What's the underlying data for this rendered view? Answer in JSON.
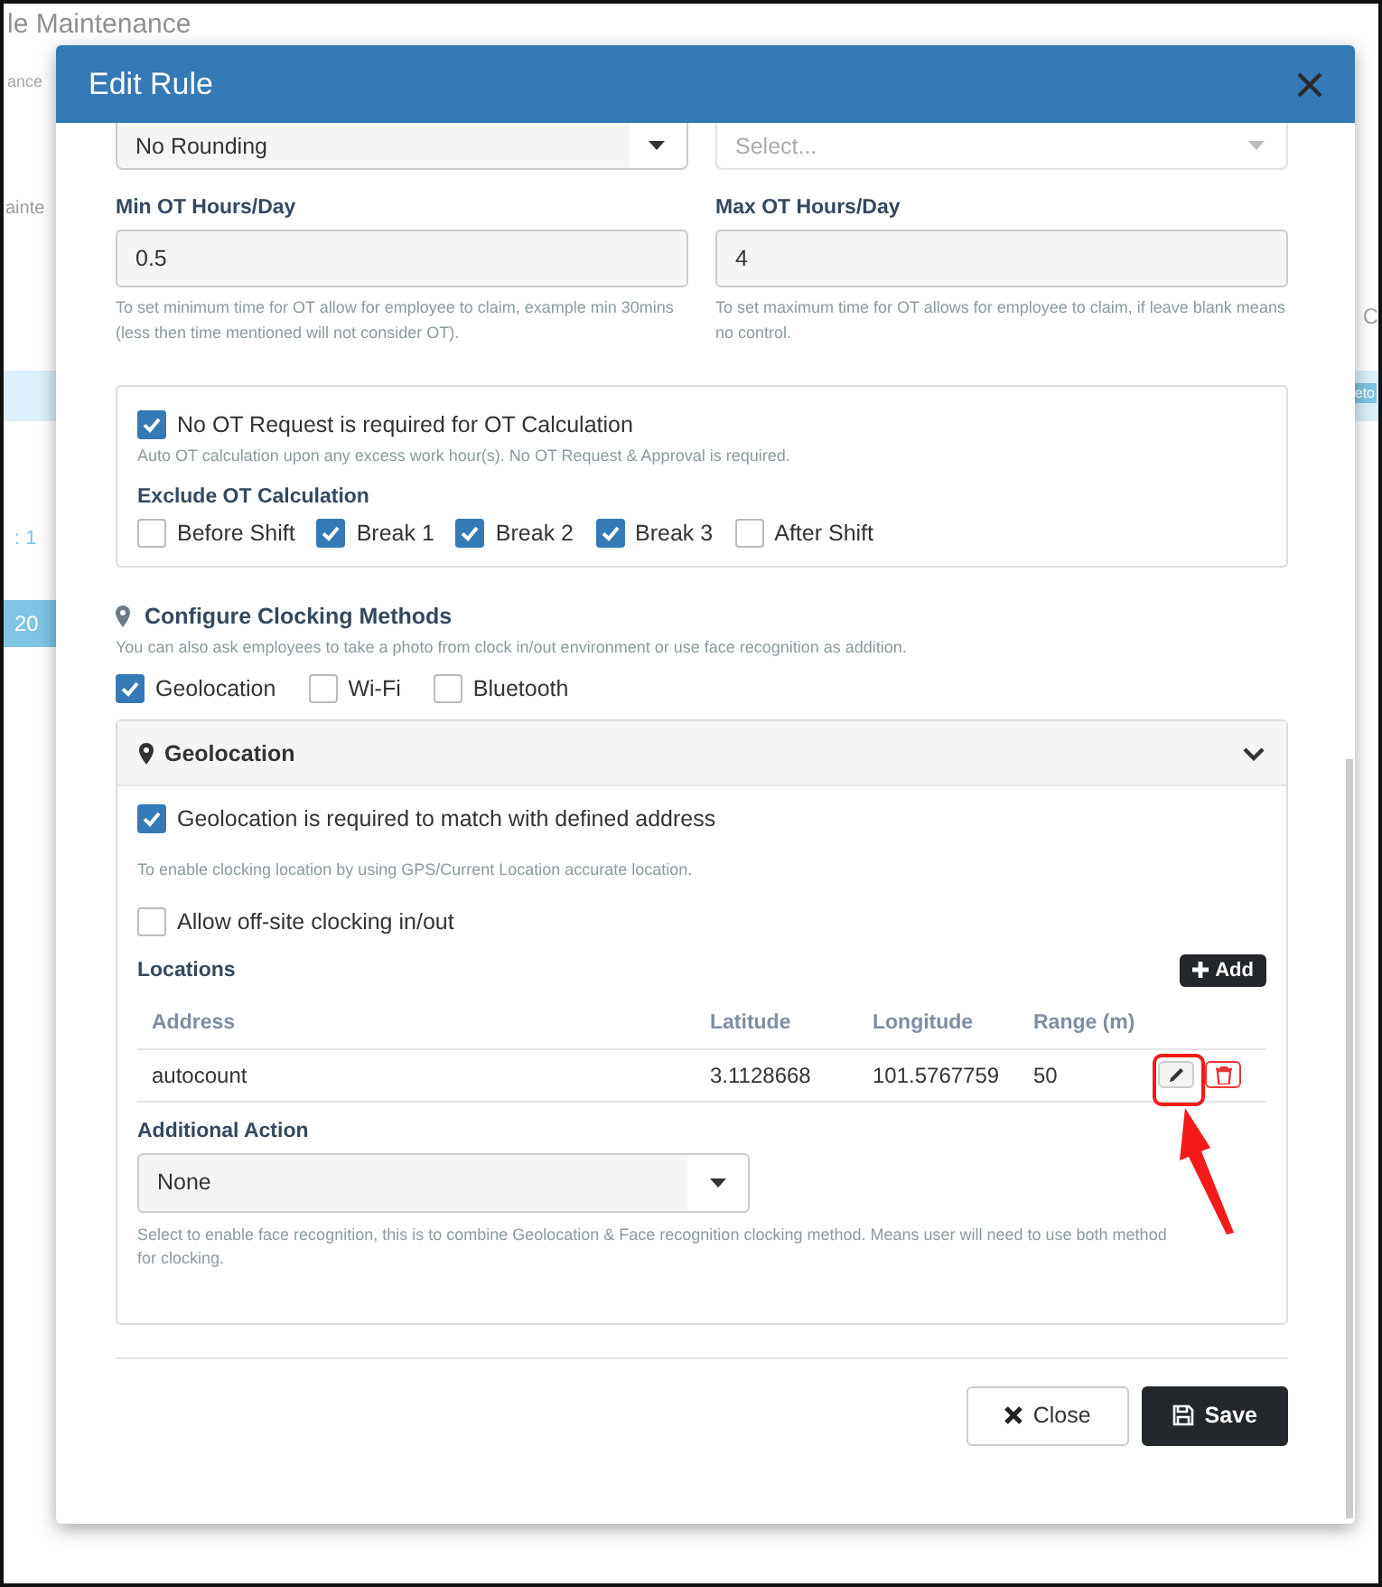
{
  "background": {
    "title": "le Maintenance",
    "subtitle": "ance",
    "tab": "ainte",
    "left_cells": [
      ": 1",
      "20"
    ],
    "right_cells": [
      "C",
      "eto"
    ]
  },
  "modal": {
    "title": "Edit Rule",
    "rounding_select": {
      "value": "No Rounding"
    },
    "second_select": {
      "placeholder": "Select..."
    },
    "min_ot": {
      "label": "Min OT Hours/Day",
      "value": "0.5",
      "help": "To set minimum time for OT allow for employee to claim, example min 30mins (less then time mentioned will not consider OT)."
    },
    "max_ot": {
      "label": "Max OT Hours/Day",
      "value": "4",
      "help": "To set maximum time for OT allows for employee to claim, if leave blank means no control."
    },
    "no_ot_request": {
      "label": "No OT Request is required for OT Calculation",
      "checked": true,
      "help": "Auto OT calculation upon any excess work hour(s). No OT Request & Approval is required."
    },
    "exclude": {
      "title": "Exclude OT Calculation",
      "options": [
        {
          "label": "Before Shift",
          "checked": false
        },
        {
          "label": "Break 1",
          "checked": true
        },
        {
          "label": "Break 2",
          "checked": true
        },
        {
          "label": "Break 3",
          "checked": true
        },
        {
          "label": "After Shift",
          "checked": false
        }
      ]
    },
    "clocking": {
      "title": "Configure Clocking Methods",
      "help": "You can also ask employees to take a photo from clock in/out environment or use face recognition as addition.",
      "methods": [
        {
          "label": "Geolocation",
          "checked": true
        },
        {
          "label": "Wi-Fi",
          "checked": false
        },
        {
          "label": "Bluetooth",
          "checked": false
        }
      ]
    },
    "geolocation_panel": {
      "title": "Geolocation",
      "expanded": true,
      "required": {
        "label": "Geolocation is required to match with defined address",
        "checked": true
      },
      "required_help": "To enable clocking location by using GPS/Current Location accurate location.",
      "offsite": {
        "label": "Allow off-site clocking in/out",
        "checked": false
      },
      "locations_title": "Locations",
      "add_button": "Add",
      "columns": [
        "Address",
        "Latitude",
        "Longitude",
        "Range (m)"
      ],
      "rows": [
        {
          "address": "autocount",
          "latitude": "3.1128668",
          "longitude": "101.5767759",
          "range": "50"
        }
      ],
      "additional_action": {
        "label": "Additional Action",
        "value": "None",
        "help": "Select to enable face recognition, this is to combine Geolocation & Face recognition clocking method. Means user will need to use both method for clocking."
      }
    },
    "buttons": [
      {
        "kind": "close",
        "label": "Close"
      },
      {
        "kind": "save",
        "label": "Save"
      }
    ]
  }
}
